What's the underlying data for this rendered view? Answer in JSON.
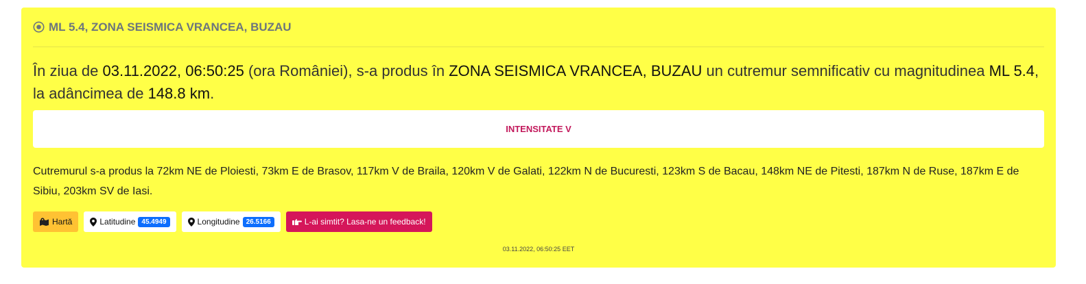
{
  "header": {
    "title": "ML 5.4, ZONA SEISMICA VRANCEA, BUZAU",
    "icon": "record-circle-icon"
  },
  "lead": {
    "p1": "În ziua de ",
    "datetime": "03.11.2022, 06:50:25",
    "p2": " (ora României), s-a produs în ",
    "zone": "ZONA SEISMICA VRANCEA, BUZAU",
    "p3": " un cutremur semnificativ cu magnitudinea ",
    "magnitude": "ML 5.4",
    "p4": ", la adâncimea de ",
    "depth": "148.8 km",
    "p5": "."
  },
  "intensity": "INTENSITATE V",
  "distances": "Cutremurul s-a produs la 72km NE de Ploiesti, 73km E de Brasov, 117km V de Braila, 120km V de Galati, 122km N de Bucuresti, 123km S de Bacau, 148km NE de Pitesti, 187km N de Ruse, 187km E de Sibiu, 203km SV de Iasi.",
  "buttons": {
    "map_label": "Hartă",
    "lat_label": "Latitudine",
    "lat_value": "45.4949",
    "lon_label": "Longitudine",
    "lon_value": "26.5166",
    "feedback_label": "L-ai simtit? Lasa-ne un feedback!"
  },
  "timestamp": "03.11.2022, 06:50:25 EET",
  "colors": {
    "card_bg": "#ffff47",
    "map_btn": "#ffc233",
    "feedback_btn": "#d5165a",
    "badge": "#0d6efd",
    "intensity_text": "#c2185b"
  }
}
